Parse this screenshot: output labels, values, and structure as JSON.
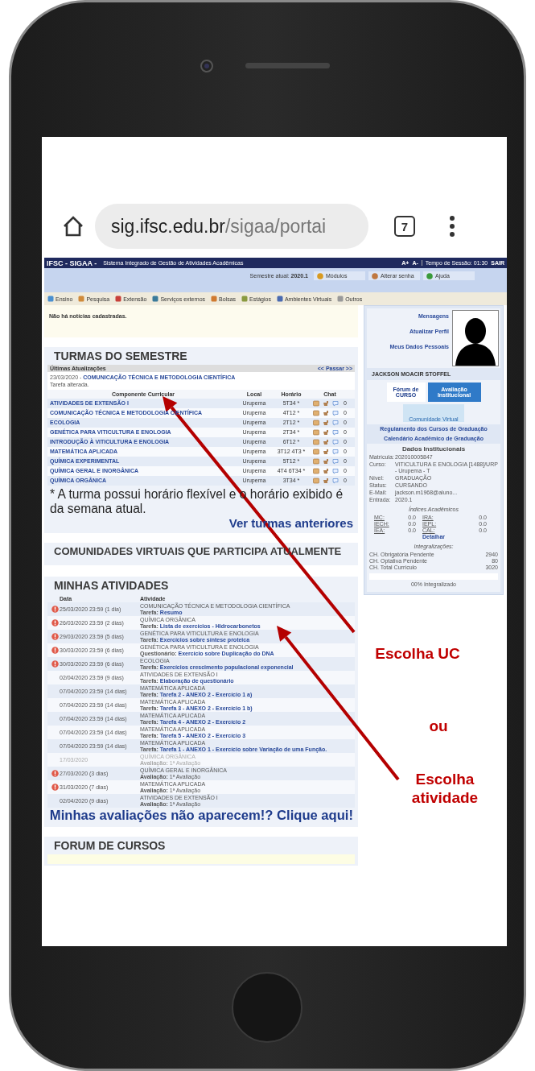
{
  "browser": {
    "url_host": "sig.ifsc.edu.br",
    "url_path": "/sigaa/portai",
    "tab_count": "7"
  },
  "header": {
    "brand": "IFSC - SIGAA -",
    "system_name": "Sistema Integrado de Gestão de Atividades Acadêmicas",
    "font_controls": [
      "A+",
      "A-"
    ],
    "session": "Tempo de Sessão: 01:30",
    "logout": "SAIR"
  },
  "semester": {
    "label": "Semestre atual:",
    "value": "2020.1"
  },
  "top_buttons": [
    {
      "label": "Módulos",
      "kind": "modules"
    },
    {
      "label": "Alterar senha",
      "kind": "password"
    },
    {
      "label": "Ajuda",
      "kind": "help"
    }
  ],
  "menu": [
    "Ensino",
    "Pesquisa",
    "Extensão",
    "Serviços externos",
    "Bolsas",
    "Estágios",
    "Ambientes Virtuais",
    "Outros"
  ],
  "news": "Não há notícias cadastradas.",
  "turmas": {
    "title": "TURMAS DO SEMESTRE",
    "updates_title": "Últimas Atualizações",
    "pager": "<< Passar >>",
    "update_date": "23/03/2020 -",
    "update_course": "COMUNICAÇÃO TÉCNICA E METODOLOGIA CIENTÍFICA",
    "update_note": "Tarefa alterada.",
    "columns": [
      "Componente Curricular",
      "Local",
      "Horário",
      "Chat"
    ],
    "rows": [
      {
        "name": "ATIVIDADES DE EXTENSÃO I",
        "local": "Urupema",
        "schedule": "5T34 *",
        "chat": "0"
      },
      {
        "name": "COMUNICAÇÃO TÉCNICA E METODOLOGIA CIENTÍFICA",
        "local": "Urupema",
        "schedule": "4T12 *",
        "chat": "0"
      },
      {
        "name": "ECOLOGIA",
        "local": "Urupema",
        "schedule": "2T12 *",
        "chat": "0"
      },
      {
        "name": "GENÉTICA PARA VITICULTURA E ENOLOGIA",
        "local": "Urupema",
        "schedule": "2T34 *",
        "chat": "0"
      },
      {
        "name": "INTRODUÇÃO À VITICULTURA E ENOLOGIA",
        "local": "Urupema",
        "schedule": "6T12 *",
        "chat": "0"
      },
      {
        "name": "MATEMÁTICA APLICADA",
        "local": "Urupema",
        "schedule": "3T12 4T3 *",
        "chat": "0"
      },
      {
        "name": "QUÍMICA EXPERIMENTAL",
        "local": "Urupema",
        "schedule": "5T12 *",
        "chat": "0"
      },
      {
        "name": "QUÍMICA GERAL E INORGÂNICA",
        "local": "Urupema",
        "schedule": "4T4 6T34 *",
        "chat": "0"
      },
      {
        "name": "QUÍMICA ORGÂNICA",
        "local": "Urupema",
        "schedule": "3T34 *",
        "chat": "0"
      }
    ],
    "footnote": "* A turma possui horário flexível e o horário exibido é da semana atual.",
    "link": "Ver turmas anteriores"
  },
  "comunidades": {
    "title": "COMUNIDADES VIRTUAIS QUE PARTICIPA ATUALMENTE"
  },
  "atividades": {
    "title": "MINHAS ATIVIDADES",
    "columns": [
      "Data",
      "Atividade"
    ],
    "rows": [
      {
        "alert": true,
        "past": false,
        "kind": "task",
        "date": "25/03/2020 23:59 (1 dia)",
        "course": "COMUNICAÇÃO TÉCNICA E METODOLOGIA CIENTÍFICA",
        "type_label": "Tarefa:",
        "name": "Resumo"
      },
      {
        "alert": true,
        "past": false,
        "kind": "task",
        "date": "26/03/2020 23:59 (2 dias)",
        "course": "QUÍMICA ORGÂNICA",
        "type_label": "Tarefa:",
        "name": "Lista de exercícios - Hidrocarbonetos"
      },
      {
        "alert": true,
        "past": false,
        "kind": "task",
        "date": "29/03/2020 23:59 (5 dias)",
        "course": "GENÉTICA PARA VITICULTURA E ENOLOGIA",
        "type_label": "Tarefa:",
        "name": "Exercícios sobre síntese proteica"
      },
      {
        "alert": true,
        "past": false,
        "kind": "task",
        "date": "30/03/2020 23:59 (6 dias)",
        "course": "GENÉTICA PARA VITICULTURA E ENOLOGIA",
        "type_label": "Questionário:",
        "name": "Exercício sobre Duplicação do DNA"
      },
      {
        "alert": true,
        "past": false,
        "kind": "task",
        "date": "30/03/2020 23:59 (6 dias)",
        "course": "ECOLOGIA",
        "type_label": "Tarefa:",
        "name": "Exercícios crescimento populacional exponencial"
      },
      {
        "alert": false,
        "past": false,
        "kind": "task",
        "date": "02/04/2020 23:59 (9 dias)",
        "course": "ATIVIDADES DE EXTENSÃO I",
        "type_label": "Tarefa:",
        "name": "Elaboração de questionário"
      },
      {
        "alert": false,
        "past": false,
        "kind": "task",
        "date": "07/04/2020 23:59 (14 dias)",
        "course": "MATEMÁTICA APLICADA",
        "type_label": "Tarefa:",
        "name": "Tarefa 2 - ANEXO 2 - Exercício 1 a)"
      },
      {
        "alert": false,
        "past": false,
        "kind": "task",
        "date": "07/04/2020 23:59 (14 dias)",
        "course": "MATEMÁTICA APLICADA",
        "type_label": "Tarefa:",
        "name": "Tarefa 3 - ANEXO 2 - Exercício 1 b)"
      },
      {
        "alert": false,
        "past": false,
        "kind": "task",
        "date": "07/04/2020 23:59 (14 dias)",
        "course": "MATEMÁTICA APLICADA",
        "type_label": "Tarefa:",
        "name": "Tarefa 4 - ANEXO 2 - Exercício 2"
      },
      {
        "alert": false,
        "past": false,
        "kind": "task",
        "date": "07/04/2020 23:59 (14 dias)",
        "course": "MATEMÁTICA APLICADA",
        "type_label": "Tarefa:",
        "name": "Tarefa 5 - ANEXO 2 - Exercício 3"
      },
      {
        "alert": false,
        "past": false,
        "kind": "task",
        "date": "07/04/2020 23:59 (14 dias)",
        "course": "MATEMÁTICA APLICADA",
        "type_label": "Tarefa:",
        "name": "Tarefa 1 - ANEXO 1 - Exercício sobre Variação de uma Função."
      },
      {
        "alert": false,
        "past": true,
        "kind": "exam",
        "date": "17/03/2020",
        "course": "QUÍMICA ORGÂNICA",
        "type_label": "Avaliação:",
        "name": "1ª Avaliação"
      },
      {
        "alert": true,
        "past": false,
        "kind": "exam",
        "date": "27/03/2020 (3 dias)",
        "course": "QUÍMICA GERAL E INORGÂNICA",
        "type_label": "Avaliação:",
        "name": "1ª Avaliação"
      },
      {
        "alert": true,
        "past": false,
        "kind": "exam",
        "date": "31/03/2020 (7 dias)",
        "course": "MATEMÁTICA APLICADA",
        "type_label": "Avaliação:",
        "name": "1ª Avaliação"
      },
      {
        "alert": false,
        "past": false,
        "kind": "exam",
        "date": "02/04/2020 (9 dias)",
        "course": "ATIVIDADES DE EXTENSÃO I",
        "type_label": "Avaliação:",
        "name": "1ª Avaliação"
      }
    ],
    "link": "Minhas avaliações não aparecem!? Clique aqui!"
  },
  "forum": {
    "title": "FORUM DE CURSOS"
  },
  "sidebar": {
    "profile_links": [
      "Mensagens",
      "Atualizar Perfil",
      "Meus Dados Pessoais"
    ],
    "user_name": "JACKSON MOACIR STOFFEL",
    "forum_logo": "Fórum de CURSO",
    "evaluation_logo": "Avaliação Institucional",
    "community_logo": "Comunidade Virtual",
    "links": [
      "Regulamento dos Cursos de Graduação",
      "Calendário Acadêmico de Graduação"
    ],
    "data_title": "Dados Institucionais",
    "fields": [
      {
        "label": "Matrícula:",
        "value": "202010005847"
      },
      {
        "label": "Curso:",
        "value": "VITICULTURA E ENOLOGIA [1488]/URP - Urupema - T"
      },
      {
        "label": "Nível:",
        "value": "GRADUAÇÃO"
      },
      {
        "label": "Status:",
        "value": "CURSANDO"
      },
      {
        "label": "E-Mail:",
        "value": "jackson.m1968@aluno..."
      },
      {
        "label": "Entrada:",
        "value": "2020.1"
      }
    ],
    "indices_title": "Índices Acadêmicos",
    "indices": [
      {
        "label": "MC:",
        "value": "0.0"
      },
      {
        "label": "IRA:",
        "value": "0.0"
      },
      {
        "label": "IECH:",
        "value": "0.0"
      },
      {
        "label": "IEPL:",
        "value": "0.0"
      },
      {
        "label": "IEA:",
        "value": "0.0"
      },
      {
        "label": "CAL:",
        "value": "0.0"
      }
    ],
    "details_link": "Detalhar",
    "integ_title": "Integralizações:",
    "integ": [
      {
        "label": "CH. Obrigatória Pendente",
        "value": "2940"
      },
      {
        "label": "CH. Optativa Pendente",
        "value": "80"
      },
      {
        "label": "CH. Total Currículo",
        "value": "3020"
      }
    ],
    "progress": {
      "level": 0,
      "label": "00% Integralizado"
    }
  },
  "annotations": [
    "Escolha UC",
    "ou",
    "Escolha atividade"
  ]
}
